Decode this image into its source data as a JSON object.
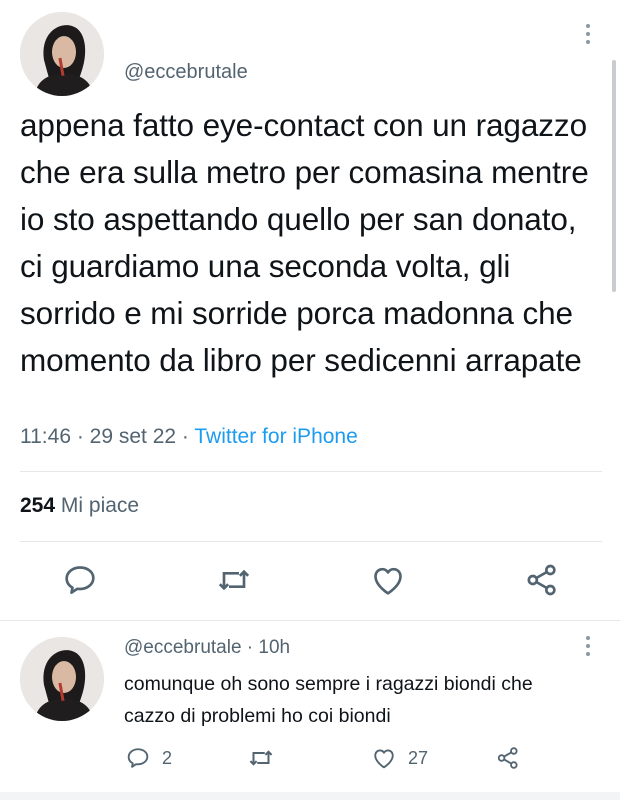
{
  "tweet": {
    "handle": "@eccebrutale",
    "text": "appena fatto eye-contact con un ragazzo che era sulla metro per comasina mentre io sto aspettando quello per san donato, ci guardiamo una seconda volta, gli sorrido e mi sorride porca madonna che momento da libro per sedicenni arrapate",
    "time": "11:46",
    "date": "29 set 22",
    "separator": " · ",
    "source": "Twitter for iPhone",
    "likes_count": "254",
    "likes_label": "Mi piace"
  },
  "actions": {
    "icons": [
      "reply-icon",
      "retweet-icon",
      "like-icon",
      "share-icon"
    ]
  },
  "reply": {
    "handle": "@eccebrutale",
    "time_ago": "10h",
    "separator": " · ",
    "text": "comunque oh sono sempre i ragazzi biondi che cazzo di problemi ho coi biondi",
    "reply_count": "2",
    "like_count": "27"
  },
  "colors": {
    "text": "#0f1419",
    "secondary": "#536471",
    "link": "#1d9bf0",
    "divider": "#e4e8eb"
  }
}
